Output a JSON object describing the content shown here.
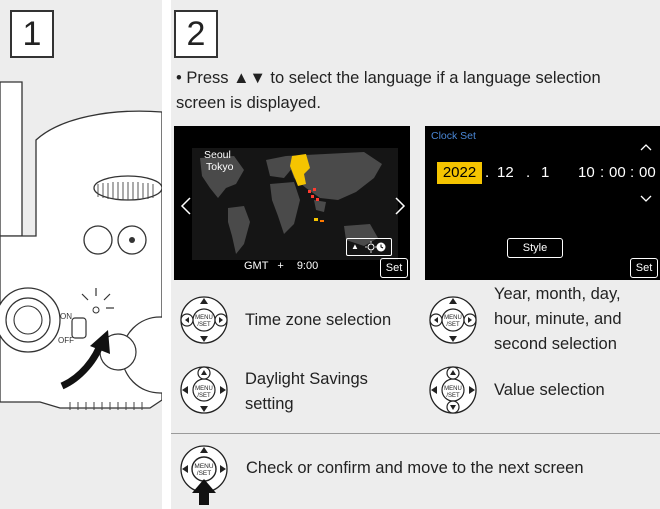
{
  "steps": {
    "step1": "1",
    "step2": "2"
  },
  "instruction": {
    "bullet": "•",
    "text": "Press ▲▼ to select the language if a language selection screen is displayed."
  },
  "camera": {
    "off_label": "OFF",
    "on_label": "ON"
  },
  "world_screen": {
    "city1": "Seoul",
    "city2": "Tokyo",
    "gmt_label": "GMT",
    "gmt_sign": "+",
    "gmt_offset": "9:00",
    "set_label": "Set",
    "dst_arrow": "▲"
  },
  "clock_screen": {
    "title": "Clock Set",
    "year": "2022",
    "dot1": ".",
    "month": "12",
    "dot2": ".",
    "day": "1",
    "hour": "10",
    "colon1": ":",
    "minute": "00",
    "colon2": ":",
    "second": "00",
    "style_label": "Style",
    "set_label": "Set"
  },
  "controls": {
    "time_zone": "Time zone selection",
    "date_time": [
      "Year, month, day,",
      "hour, minute, and",
      "second selection"
    ],
    "dst": [
      "Daylight Savings",
      "setting"
    ],
    "value": "Value selection",
    "confirm": "Check or confirm and move to the next screen"
  },
  "icons": {
    "menu_set_line1": "MENU",
    "menu_set_line2": "/SET"
  },
  "colors": {
    "panel": "#ededed",
    "highlight_yellow": "#f5c400",
    "clock_title_blue": "#4a87d6",
    "map_land": "#4a4a4a",
    "map_ocean": "#151515"
  }
}
